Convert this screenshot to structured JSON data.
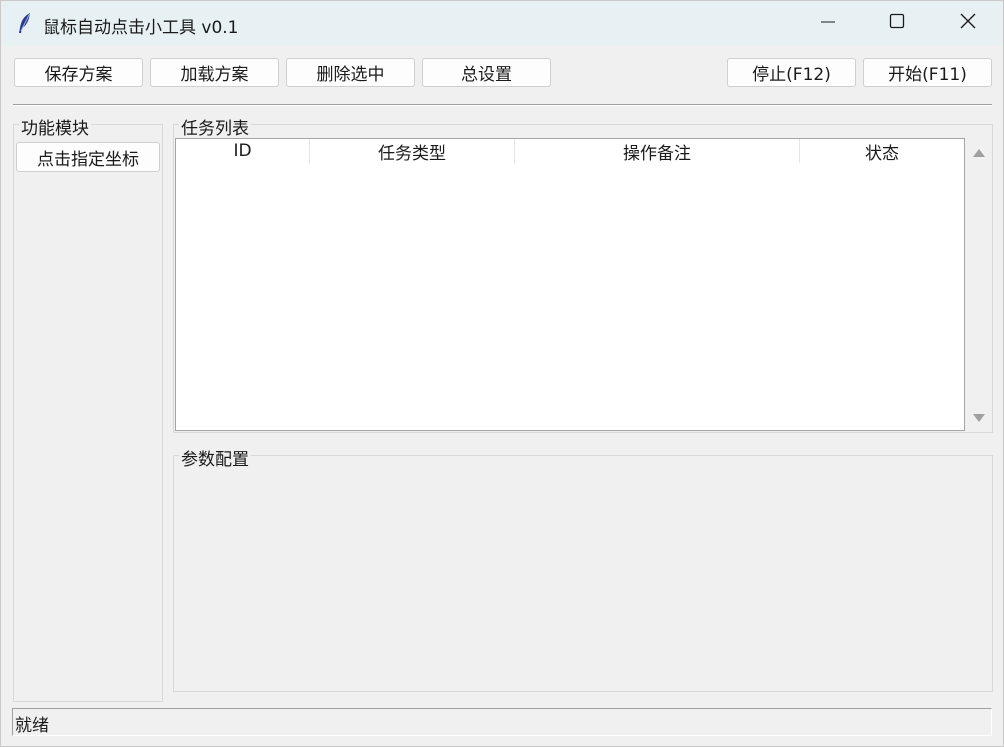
{
  "window": {
    "title": "鼠标自动点击小工具 v0.1"
  },
  "toolbar": {
    "save_label": "保存方案",
    "load_label": "加载方案",
    "delete_label": "删除选中",
    "settings_label": "总设置",
    "stop_label": "停止(F12)",
    "start_label": "开始(F11)"
  },
  "modules": {
    "title": "功能模块",
    "items": [
      {
        "label": "点击指定坐标"
      }
    ]
  },
  "tasks": {
    "title": "任务列表",
    "columns": [
      "ID",
      "任务类型",
      "操作备注",
      "状态"
    ],
    "rows": []
  },
  "params": {
    "title": "参数配置"
  },
  "status": {
    "text": "就绪"
  },
  "colors": {
    "titlebar_bg": "#e7f1f4",
    "window_bg": "#f0f0f0",
    "list_bg": "#ffffff",
    "button_bg": "#fdfdfd"
  },
  "icons": {
    "app": "feather-icon",
    "minimize": "minimize-icon",
    "maximize": "maximize-icon",
    "close": "close-icon",
    "scroll_up": "scroll-up-arrow-icon",
    "scroll_down": "scroll-down-arrow-icon"
  }
}
